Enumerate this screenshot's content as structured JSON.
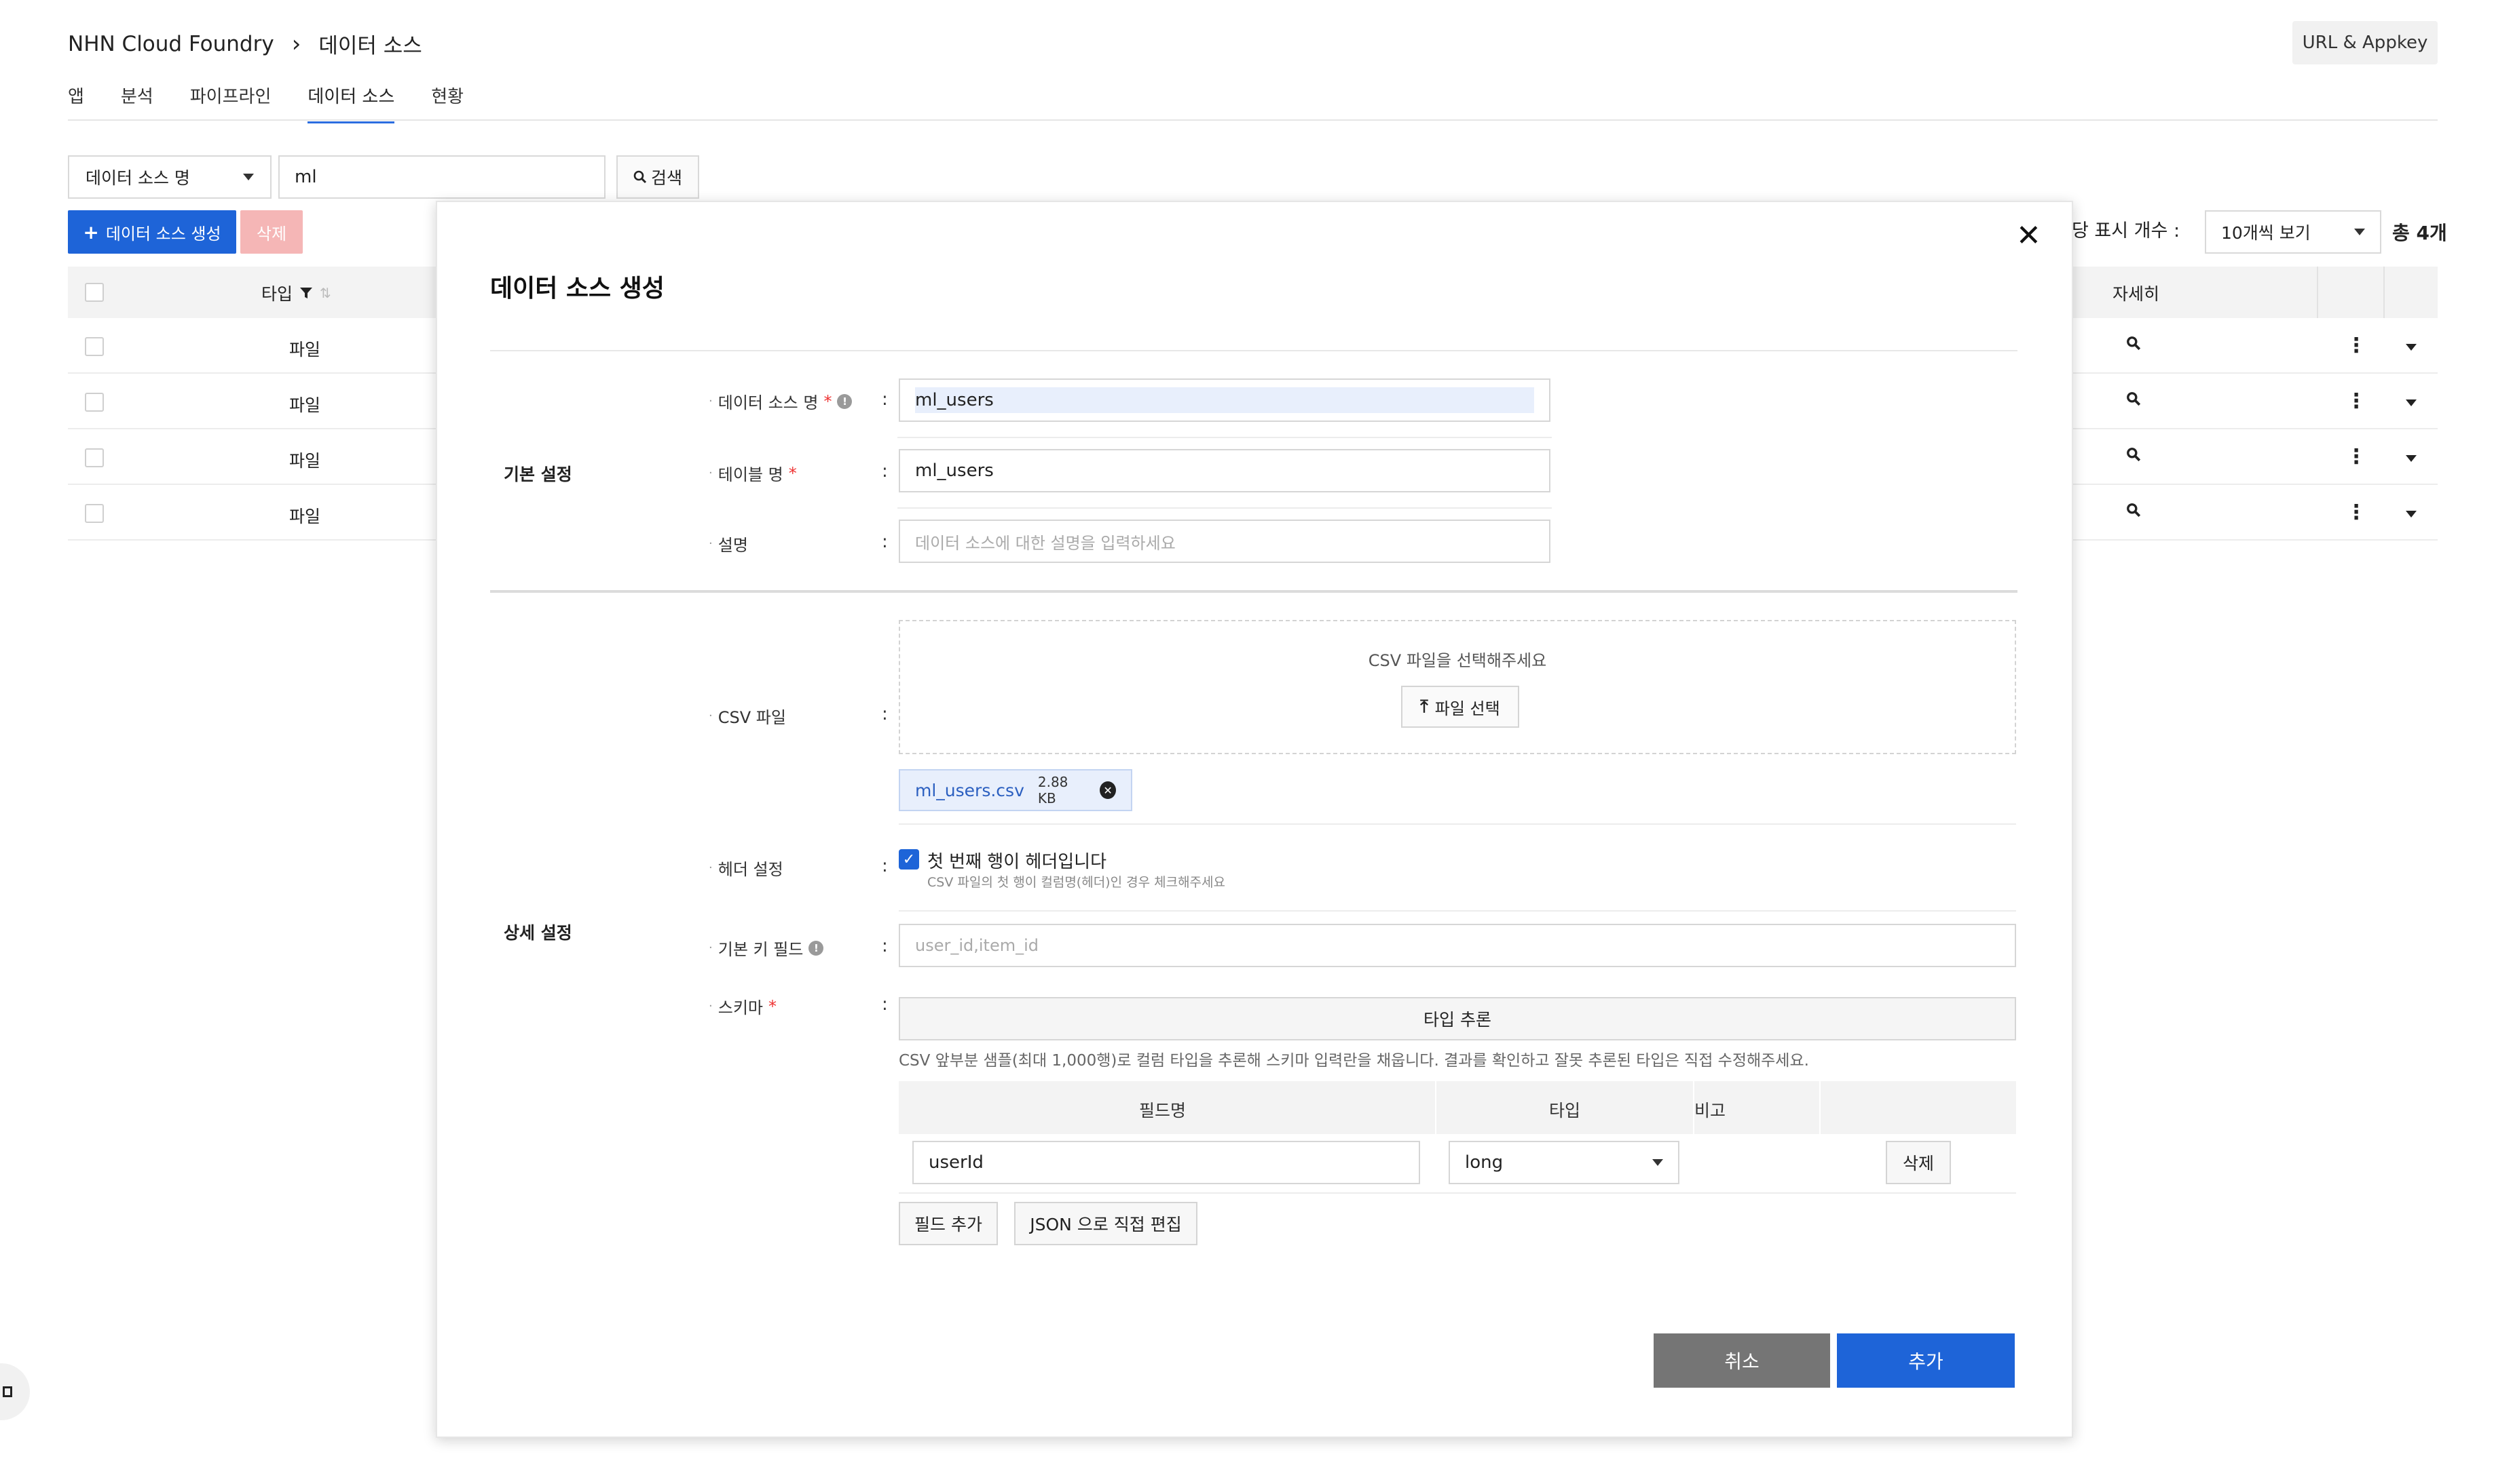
{
  "header": {
    "breadcrumb_root": "NHN Cloud Foundry",
    "breadcrumb_sep": "›",
    "breadcrumb_current": "데이터 소스",
    "url_appkey": "URL & Appkey",
    "tabs": [
      "앱",
      "분석",
      "파이프라인",
      "데이터 소스",
      "현황"
    ],
    "active_tab": "데이터 소스"
  },
  "search": {
    "field_select": "데이터 소스 명",
    "query": "ml",
    "search_label": "검색"
  },
  "toolbar": {
    "create_label": "데이터 소스 생성",
    "delete_label": "삭제",
    "per_page_label": "당 표시 개수 :",
    "per_page_value": "10개씩 보기",
    "total": "총 4개"
  },
  "table": {
    "col_type": "타입",
    "col_detail": "자세히",
    "rows": [
      {
        "type": "파일"
      },
      {
        "type": "파일"
      },
      {
        "type": "파일"
      },
      {
        "type": "파일"
      }
    ]
  },
  "modal": {
    "title": "데이터 소스 생성",
    "basic_section": "기본 설정",
    "detail_section": "상세 설정",
    "fields": {
      "datasource_name_label": "데이터 소스 명",
      "datasource_name_value": "ml_users",
      "table_name_label": "테이블 명",
      "table_name_value": "ml_users",
      "description_label": "설명",
      "description_placeholder": "데이터 소스에 대한 설명을 입력하세요",
      "csv_label": "CSV 파일",
      "csv_prompt": "CSV 파일을 선택해주세요",
      "file_select_label": "파일 선택",
      "uploaded_file_name": "ml_users.csv",
      "uploaded_file_size": "2.88 KB",
      "header_label": "헤더 설정",
      "header_checkbox_label": "첫 번째 행이 헤더입니다",
      "header_hint": "CSV 파일의 첫 행이 컬럼명(헤더)인 경우 체크해주세요",
      "pk_label": "기본 키 필드",
      "pk_placeholder": "user_id,item_id",
      "schema_label": "스키마",
      "infer_label": "타입 추론",
      "infer_note": "CSV 앞부분 샘플(최대 1,000행)로 컬럼 타입을 추론해 스키마 입력란을 채웁니다. 결과를 확인하고 잘못 추론된 타입은 직접 수정해주세요."
    },
    "schema": {
      "col_field": "필드명",
      "col_type": "타입",
      "col_note": "비고",
      "rows": [
        {
          "field": "userId",
          "type": "long",
          "delete_label": "삭제"
        }
      ],
      "add_field_label": "필드 추가",
      "json_edit_label": "JSON 으로 직접 편집"
    },
    "cancel_label": "취소",
    "add_label": "추가"
  },
  "colors": {
    "primary": "#1e64d8",
    "danger_light": "#f5b6b6",
    "required": "#ee3333",
    "cancel": "#757575"
  }
}
